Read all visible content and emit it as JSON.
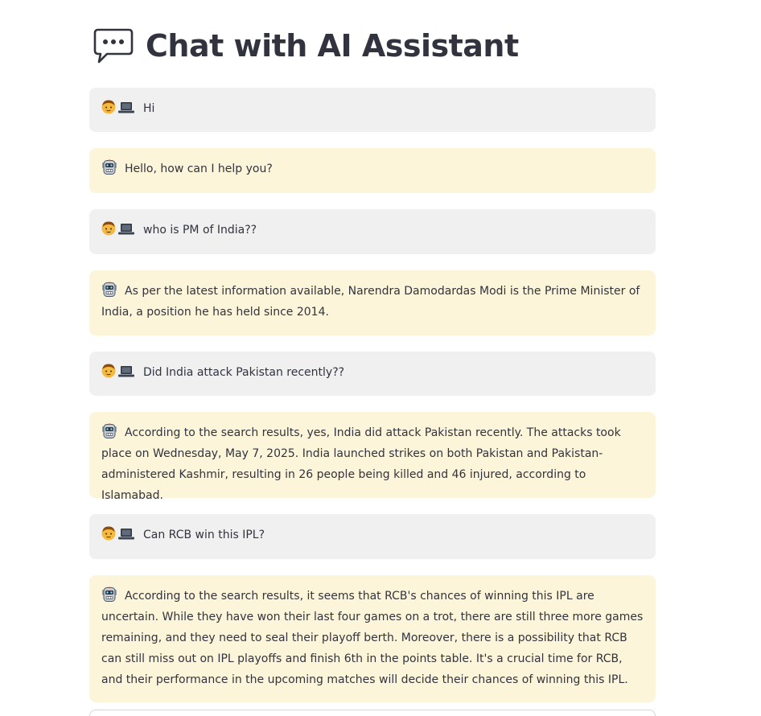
{
  "page": {
    "title": "Chat with AI Assistant",
    "title_icon": "speech-bubble-icon"
  },
  "icons": {
    "user": "user-with-laptop-icon",
    "assistant": "robot-icon"
  },
  "colors": {
    "user_bubble": "#f0f0f0",
    "assistant_bubble": "#fdf5d9",
    "text": "#31333f"
  },
  "messages": [
    {
      "role": "user",
      "text": "Hi"
    },
    {
      "role": "assistant",
      "text": "Hello, how can I help you?"
    },
    {
      "role": "user",
      "text": "who is PM of India??"
    },
    {
      "role": "assistant",
      "text": "As per the latest information available, Narendra Damodardas Modi is the Prime Minister of India, a position he has held since 2014."
    },
    {
      "role": "user",
      "text": "Did India attack Pakistan recently??"
    },
    {
      "role": "assistant",
      "text": "According to the search results, yes, India did attack Pakistan recently. The attacks took place on Wednesday, May 7, 2025. India launched strikes on both Pakistan and Pakistan-administered Kashmir, resulting in 26 people being killed and 46 injured, according to Islamabad."
    },
    {
      "role": "user",
      "text": "Can RCB win this IPL?"
    },
    {
      "role": "assistant",
      "text": "According to the search results, it seems that RCB's chances of winning this IPL are uncertain. While they have won their last four games on a trot, there are still three more games remaining, and they need to seal their playoff berth. Moreover, there is a possibility that RCB can still miss out on IPL playoffs and finish 6th in the points table. It's a crucial time for RCB, and their performance in the upcoming matches will decide their chances of winning this IPL."
    }
  ]
}
